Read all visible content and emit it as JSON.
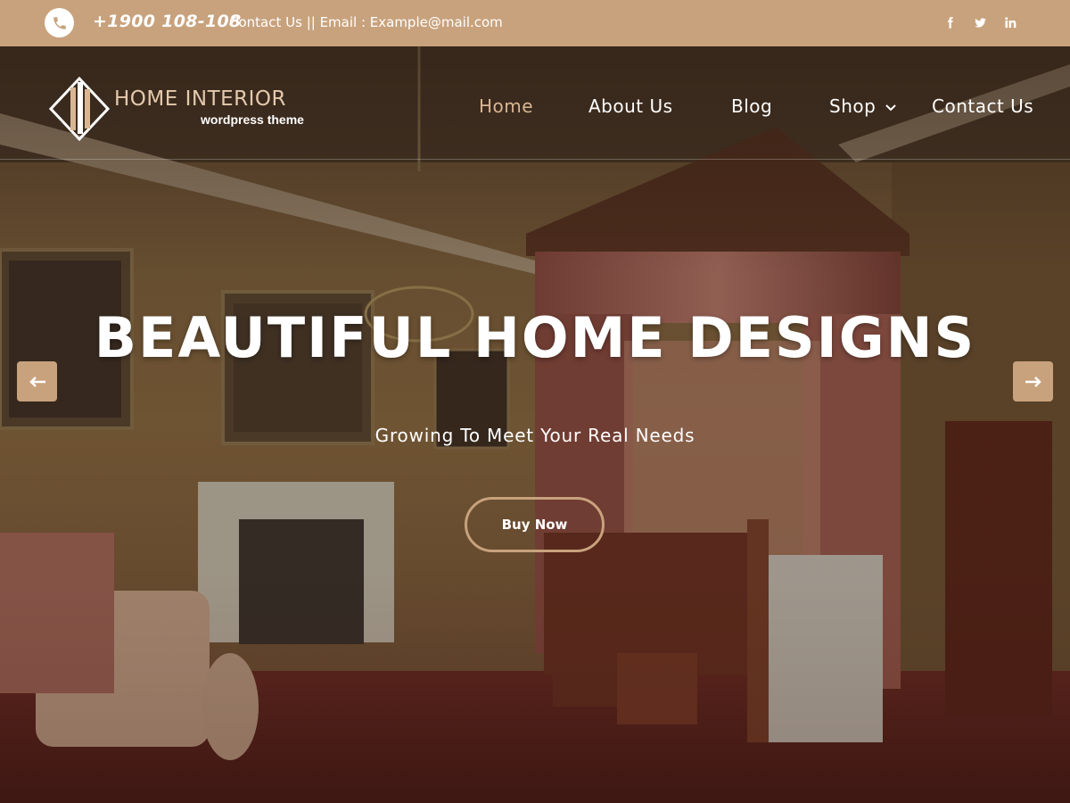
{
  "topbar": {
    "phone": "+1900 108-108",
    "contact_line": "Contact Us || Email : Example@mail.com",
    "social": [
      "facebook-icon",
      "twitter-icon",
      "linkedin-icon"
    ]
  },
  "logo": {
    "title": "HOME INTERIOR",
    "subtitle": "wordpress theme"
  },
  "nav": {
    "items": [
      {
        "label": "Home",
        "active": true
      },
      {
        "label": "About Us",
        "active": false
      },
      {
        "label": "Blog",
        "active": false
      },
      {
        "label": "Shop",
        "active": false,
        "has_dropdown": true
      },
      {
        "label": "Contact Us",
        "active": false
      }
    ]
  },
  "hero": {
    "headline": "BEAUTIFUL HOME DESIGNS",
    "subline": "Growing To Meet Your Real Needs",
    "button": "Buy Now",
    "prev_icon": "arrow-left-icon",
    "next_icon": "arrow-right-icon"
  },
  "colors": {
    "accent": "#c8a27d",
    "active_nav": "#d9b693",
    "text": "#ffffff"
  }
}
